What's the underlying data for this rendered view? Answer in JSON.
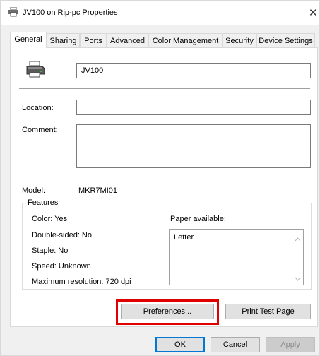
{
  "window": {
    "title": "JV100 on Rip-pc Properties",
    "close_glyph": "✕"
  },
  "tabs": [
    "General",
    "Sharing",
    "Ports",
    "Advanced",
    "Color Management",
    "Security",
    "Device Settings"
  ],
  "general": {
    "printer_name": "JV100",
    "location_label": "Location:",
    "location_value": "",
    "comment_label": "Comment:",
    "comment_value": "",
    "model_label": "Model:",
    "model_value": "MKR7MI01",
    "features_label": "Features",
    "features": {
      "color": "Color: Yes",
      "double_sided": "Double-sided: No",
      "staple": "Staple: No",
      "speed": "Speed: Unknown",
      "max_resolution": "Maximum resolution: 720 dpi"
    },
    "paper_available_label": "Paper available:",
    "paper_list": [
      "Letter"
    ],
    "preferences_button": "Preferences...",
    "print_test_page_button": "Print Test Page"
  },
  "footer": {
    "ok": "OK",
    "cancel": "Cancel",
    "apply": "Apply"
  },
  "colors": {
    "highlight_box": "#e00000",
    "focus_blue": "#0078d7"
  },
  "icons": {
    "title_icon": "printer-icon",
    "printer_icon": "printer-icon"
  }
}
